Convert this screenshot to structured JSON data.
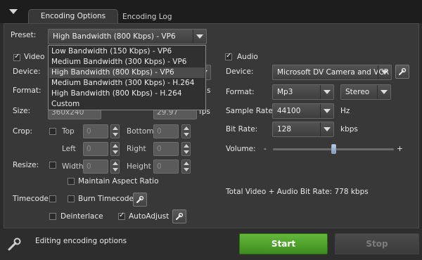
{
  "tabs": [
    {
      "label": "Encoding Options",
      "active": true
    },
    {
      "label": "Encoding Log",
      "active": false
    }
  ],
  "preset": {
    "label": "Preset:",
    "selected": "High Bandwidth (800 Kbps) - VP6",
    "options": [
      "Low Bandwidth (150 Kbps) - VP6",
      "Medium Bandwidth (300 Kbps) - VP6",
      "High Bandwidth (800 Kbps) - VP6",
      "Medium Bandwidth (300 Kbps) - H.264",
      "High Bandwidth (800 Kbps) - H.264",
      "Custom"
    ],
    "highlighted_index": 2
  },
  "video": {
    "label": "Video",
    "enabled": true,
    "device_label": "Device:",
    "format_label": "Format:",
    "format_suffix": "s",
    "size_label": "Size:",
    "size_value": "360x240",
    "fps_value": "29.97",
    "fps_unit": "fps",
    "crop": {
      "label": "Crop:",
      "top_label": "Top",
      "bottom_label": "Bottom",
      "left_label": "Left",
      "right_label": "Right",
      "top": "0",
      "bottom": "0",
      "left": "0",
      "right": "0"
    },
    "resize": {
      "label": "Resize:",
      "width_label": "Width",
      "height_label": "Height",
      "width": "0",
      "height": "0",
      "maintain_label": "Maintain Aspect Ratio"
    },
    "timecode": {
      "label": "Timecode:",
      "burn_label": "Burn Timecode"
    },
    "deinterlace_label": "Deinterlace",
    "autoadjust_label": "AutoAdjust",
    "autoadjust_on": true
  },
  "audio": {
    "label": "Audio",
    "enabled": true,
    "device_label": "Device:",
    "device_value": "Microsoft DV Camera and VCR",
    "format_label": "Format:",
    "format_value": "Mp3",
    "channels_value": "Stereo",
    "sample_rate_label": "Sample Rate:",
    "sample_rate_value": "44100",
    "sample_rate_unit": "Hz",
    "bit_rate_label": "Bit Rate:",
    "bit_rate_value": "128",
    "bit_rate_unit": "kbps",
    "volume_label": "Volume:",
    "volume_minus": "-",
    "volume_plus": "+",
    "volume_level": 0.5
  },
  "total_bitrate_text": "Total Video + Audio Bit Rate:  778 kbps",
  "status_text": "Editing encoding options",
  "buttons": {
    "start": "Start",
    "stop": "Stop"
  },
  "colors": {
    "start_green": "#52a52d",
    "selection_thumb": "#9fb7dc"
  }
}
